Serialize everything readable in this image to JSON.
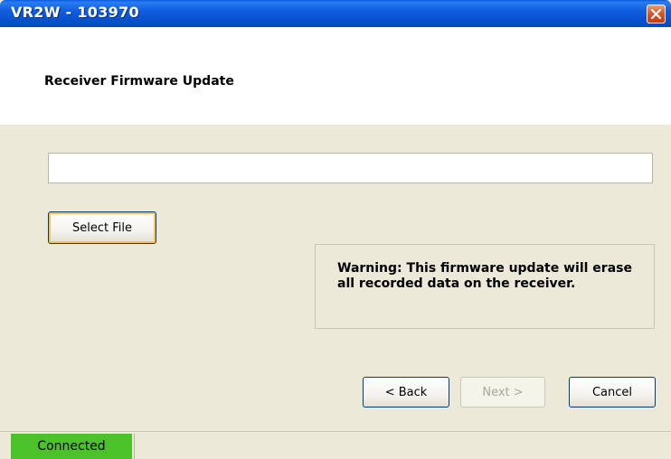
{
  "window": {
    "title": "VR2W - 103970",
    "close_icon": "close-icon"
  },
  "header": {
    "title": "Receiver Firmware Update"
  },
  "file_input": {
    "value": "",
    "placeholder": ""
  },
  "buttons": {
    "select_file": "Select File",
    "back": "< Back",
    "next": "Next >",
    "cancel": "Cancel"
  },
  "warning": {
    "text": "Warning: This firmware update will erase all recorded data on the receiver."
  },
  "status": {
    "connection": "Connected",
    "connection_color": "#4cc22a"
  },
  "colors": {
    "titlebar": "#0a52d0",
    "close_button": "#d8582a",
    "dialog_background": "#ece9d8"
  }
}
